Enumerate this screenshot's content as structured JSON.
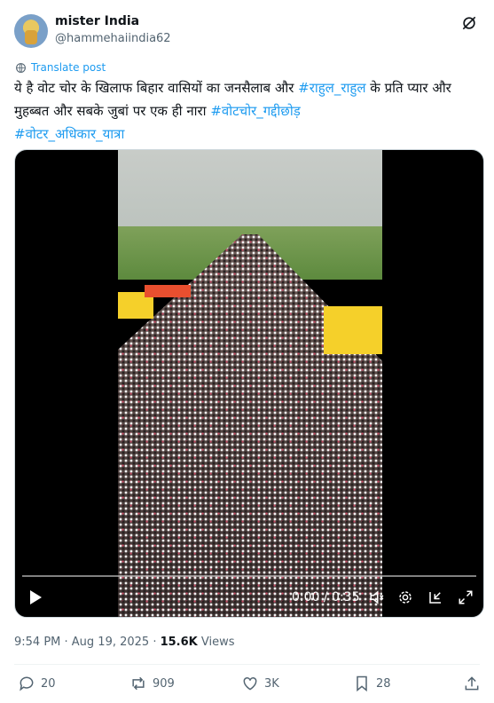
{
  "author": {
    "name": "mister India",
    "handle": "@hammehaiindia62"
  },
  "translate_label": "Translate post",
  "tweet": {
    "text_part1": "ये है वोट चोर के खिलाफ बिहार वासियों का जनसैलाब और ",
    "tag1": "#राहुल_राहुल",
    "text_part2": " के प्रति प्यार और मुहब्बत और सबके जुबां पर एक ही नारा ",
    "tag2": "#वोटचोर_गद्दीछोड़",
    "tag3": "#वोटर_अधिकार_यात्रा"
  },
  "video": {
    "time": "0:00 / 0:35"
  },
  "meta": {
    "timestamp": "9:54 PM · Aug 19, 2025 · ",
    "views_count": "15.6K",
    "views_label": " Views"
  },
  "actions": {
    "replies": "20",
    "reposts": "909",
    "likes": "3K",
    "bookmarks": "28"
  },
  "colors": {
    "accent": "#1d9bf0",
    "text": "#0f1419",
    "secondary": "#536471"
  }
}
